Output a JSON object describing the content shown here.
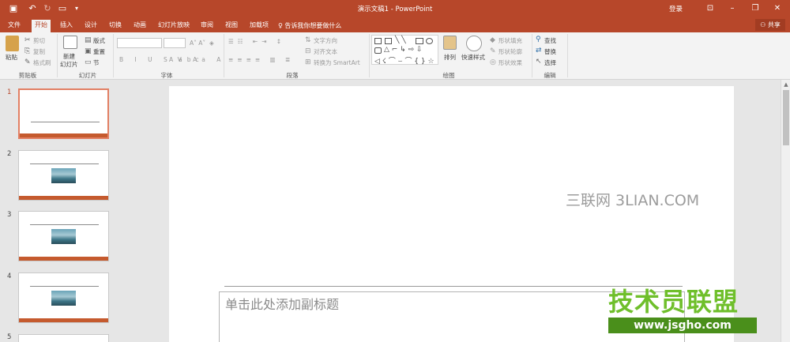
{
  "window": {
    "title": "演示文稿1 - PowerPoint",
    "login": "登录"
  },
  "tabs": [
    "文件",
    "开始",
    "插入",
    "设计",
    "切换",
    "动画",
    "幻灯片放映",
    "审阅",
    "视图",
    "加载项"
  ],
  "tell_me": "告诉我你想要做什么",
  "share_label": "共享",
  "ribbon": {
    "clipboard": {
      "paste": "粘贴",
      "cut": "剪切",
      "copy": "复制",
      "format_painter": "格式刷",
      "label": "剪贴板"
    },
    "slides": {
      "new_slide": "新建",
      "new_slide2": "幻灯片",
      "layout": "版式",
      "reset": "重置",
      "section": "节",
      "label": "幻灯片"
    },
    "font": {
      "label": "字体"
    },
    "paragraph": {
      "text_direction": "文字方向",
      "align_text": "对齐文本",
      "convert_smartart": "转换为 SmartArt",
      "label": "段落"
    },
    "drawing": {
      "arrange": "排列",
      "quick_styles": "快速样式",
      "shape_fill": "形状填充",
      "shape_outline": "形状轮廓",
      "shape_effects": "形状效果",
      "label": "绘图"
    },
    "editing": {
      "find": "查找",
      "replace": "替换",
      "select": "选择",
      "label": "编辑"
    }
  },
  "slides": [
    {
      "number": "1"
    },
    {
      "number": "2"
    },
    {
      "number": "3"
    },
    {
      "number": "4"
    },
    {
      "number": "5"
    }
  ],
  "slide_content": {
    "watermark": "三联网 3LIAN.COM",
    "subtitle_placeholder": "单击此处添加副标题"
  },
  "logo": {
    "name": "技术员联盟",
    "url": "www.jsgho.com"
  },
  "colors": {
    "accent": "#b7472a",
    "thumb_bar": "#c55a2e",
    "logo_green": "#6fbf2b"
  }
}
